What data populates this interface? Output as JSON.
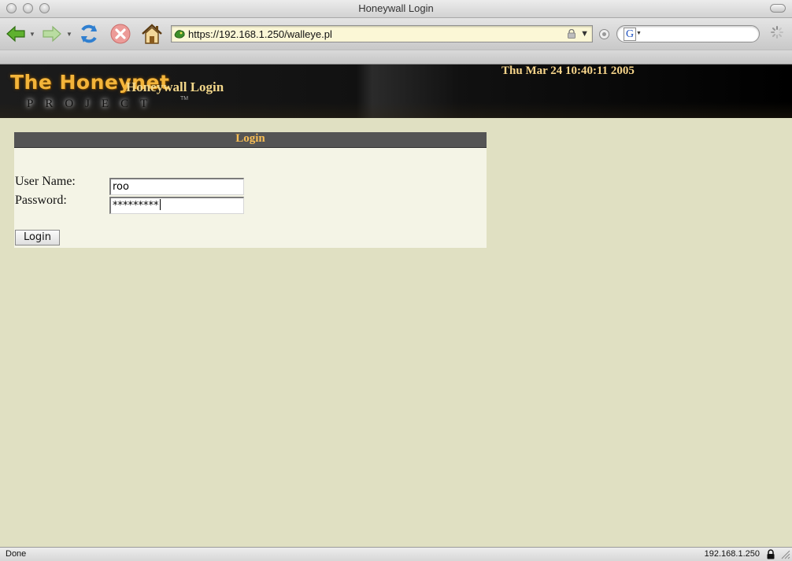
{
  "window": {
    "title": "Honeywall Login"
  },
  "toolbar": {
    "url": "https://192.168.1.250/walleye.pl",
    "search_engine_glyph": "G",
    "icons": [
      "back-icon",
      "forward-icon",
      "reload-icon",
      "stop-icon",
      "home-icon"
    ]
  },
  "page": {
    "logo_main": "The Honeynet",
    "logo_sub": "PROJECT",
    "logo_tm": "TM",
    "title": "Honeywall Login",
    "datetime": "Thu Mar 24 10:40:11 2005"
  },
  "login": {
    "header": "Login",
    "username_label": "User Name:",
    "username_value": "roo",
    "password_label": "Password:",
    "password_value": "*********",
    "button_label": "Login"
  },
  "status": {
    "left": "Done",
    "right": "192.168.1.250"
  },
  "colors": {
    "page_background": "#e0e0c2",
    "panel_background": "#f4f4e6",
    "panel_header": "#545454",
    "accent_gold": "#f8be55",
    "url_field": "#fbf7d6"
  }
}
